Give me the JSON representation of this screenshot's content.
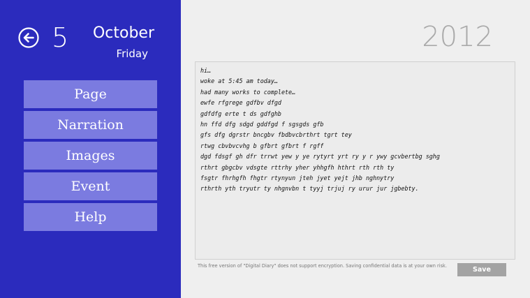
{
  "header": {
    "day_number": "5",
    "month": "October",
    "weekday": "Friday",
    "year": "2012",
    "back_icon": "arrow-left-circle-icon"
  },
  "nav": {
    "items": [
      {
        "label": "Page"
      },
      {
        "label": "Narration"
      },
      {
        "label": "Images"
      },
      {
        "label": "Event"
      },
      {
        "label": "Help"
      }
    ]
  },
  "editor": {
    "lines": [
      "hi…",
      "woke at 5:45 am today…",
      "had many works to complete…",
      "ewfe rfgrege gdfbv dfgd",
      "gdfdfg erte t  ds gdfghb",
      "hn ffd dfg sdgd gddfgd f sgsgds gfb",
      "gfs dfg  dgrstr bncgbv fbdbvcbrthrt tgrt tey",
      "rtwg cbvbvcvhg b gfbrt  gfbrt f rgff",
      "dgd fdsgf gh dfr trrwt yew y ye rytyrt yrt ry y r ywy gcvbertbg sghg",
      "rthrt gbgcbv vdsgte rttrhy yher yhhgfh hthrt rth rth ty",
      "fsgtr fhrhgfh fhgtr rtynyun jteh jyet yejt jhb nghnytry",
      "rthrth yth tryutr ty nhgnvbn t tyyj trjuj ry urur jur  jgbebty."
    ]
  },
  "footer": {
    "notice": "This free version of \"Digital Diary\" does not support encryption. Saving confidential data is at your own risk.",
    "save_label": "Save"
  },
  "colors": {
    "sidebar": "#2b2bbd",
    "nav_button": "#7b7be0",
    "background": "#efefef",
    "save_button": "#a3a3a3"
  }
}
